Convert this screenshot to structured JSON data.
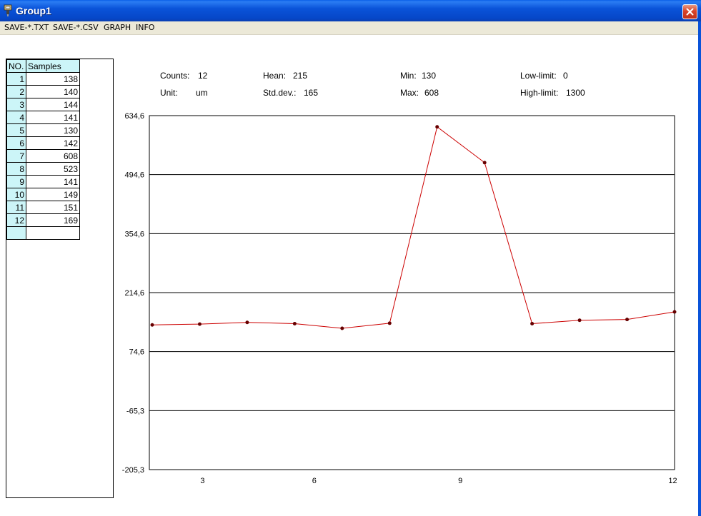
{
  "window": {
    "title": "Group1",
    "icon": "gauge-app-icon",
    "close_icon": "close-icon"
  },
  "menu": {
    "items": [
      "SAVE-*.TXT",
      "SAVE-*.CSV",
      "GRAPH",
      "INFO"
    ]
  },
  "table": {
    "headers": [
      "NO.",
      "Samples"
    ],
    "rows": [
      [
        "1",
        "138"
      ],
      [
        "2",
        "140"
      ],
      [
        "3",
        "144"
      ],
      [
        "4",
        "141"
      ],
      [
        "5",
        "130"
      ],
      [
        "6",
        "142"
      ],
      [
        "7",
        "608"
      ],
      [
        "8",
        "523"
      ],
      [
        "9",
        "141"
      ],
      [
        "10",
        "149"
      ],
      [
        "11",
        "151"
      ],
      [
        "12",
        "169"
      ]
    ]
  },
  "stats": {
    "counts_label": "Counts:",
    "counts_value": "12",
    "unit_label": "Unit:",
    "unit_value": "um",
    "mean_label": "Hean:",
    "mean_value": "215",
    "stddev_label": "Std.dev.:",
    "stddev_value": "165",
    "min_label": "Min:",
    "min_value": "130",
    "max_label": "Max:",
    "max_value": "608",
    "low_label": "Low-limit:",
    "low_value": "0",
    "high_label": "High-limit:",
    "high_value": "1300"
  },
  "chart_data": {
    "type": "line",
    "x": [
      1,
      2,
      3,
      4,
      5,
      6,
      7,
      8,
      9,
      10,
      11,
      12
    ],
    "series": [
      {
        "values": [
          138,
          140,
          144,
          141,
          130,
          142,
          608,
          523,
          141,
          149,
          151,
          169
        ],
        "color": "#cc0000"
      }
    ],
    "ylim": [
      -205.3,
      634.6
    ],
    "ytick_labels": [
      "634,6",
      "494,6",
      "354,6",
      "214,6",
      "74,6",
      "-65,3",
      "-205,3"
    ],
    "xtick_labels": [
      "3",
      "6",
      "9",
      "12"
    ],
    "xtick_at": [
      3,
      6,
      9,
      12
    ],
    "grid": true,
    "marker_color": "#660000"
  }
}
